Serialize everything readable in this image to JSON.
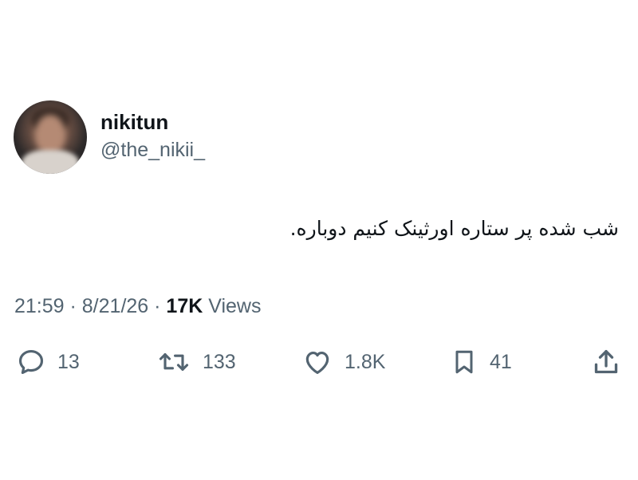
{
  "author": {
    "display_name": "nikitun",
    "handle": "@the_nikii_"
  },
  "tweet": {
    "text": "شب شده پر ستاره اورثینک کنیم دوباره."
  },
  "meta": {
    "time": "21:59",
    "separator_1": " · ",
    "date": "8/21/26",
    "separator_2": " · ",
    "views_count": "17K",
    "views_label": " Views"
  },
  "actions": {
    "reply": {
      "icon": "reply-icon",
      "count": "13"
    },
    "retweet": {
      "icon": "retweet-icon",
      "count": "133"
    },
    "like": {
      "icon": "heart-icon",
      "count": "1.8K"
    },
    "bookmark": {
      "icon": "bookmark-icon",
      "count": "41"
    },
    "share": {
      "icon": "share-icon"
    }
  },
  "colors": {
    "text_primary": "#0f1419",
    "text_secondary": "#536471",
    "background": "#ffffff"
  }
}
